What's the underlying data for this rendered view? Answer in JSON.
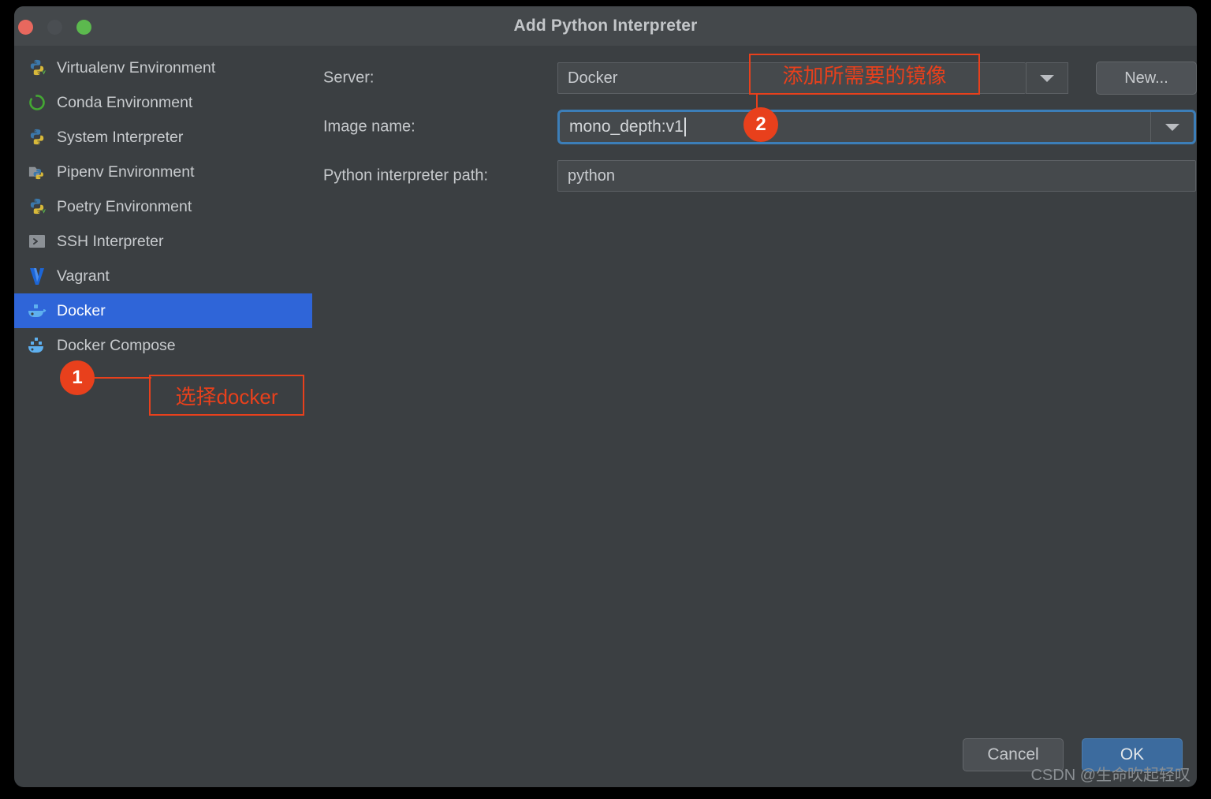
{
  "window": {
    "title": "Add Python Interpreter",
    "traffic_lights": [
      "close-red",
      "minimize-yellow",
      "zoom-green"
    ]
  },
  "colors": {
    "dialog_bg": "#3b3f42",
    "titlebar_bg": "#44484b",
    "selection_blue": "#2f65d8",
    "focus_border": "#3c7eb8",
    "annotation_red": "#e8401c",
    "ok_button_blue": "#3c6b9e",
    "text_primary": "#c8cbce"
  },
  "sidebar": {
    "items": [
      {
        "label": "Virtualenv Environment",
        "icon": "python-venv-icon",
        "selected": false
      },
      {
        "label": "Conda Environment",
        "icon": "conda-icon",
        "selected": false
      },
      {
        "label": "System Interpreter",
        "icon": "python-icon",
        "selected": false
      },
      {
        "label": "Pipenv Environment",
        "icon": "pipenv-icon",
        "selected": false
      },
      {
        "label": "Poetry Environment",
        "icon": "python-venv-icon",
        "selected": false
      },
      {
        "label": "SSH Interpreter",
        "icon": "ssh-terminal-icon",
        "selected": false
      },
      {
        "label": "Vagrant",
        "icon": "vagrant-icon",
        "selected": false
      },
      {
        "label": "Docker",
        "icon": "docker-icon",
        "selected": true
      },
      {
        "label": "Docker Compose",
        "icon": "docker-compose-icon",
        "selected": false
      }
    ]
  },
  "form": {
    "server": {
      "label": "Server:",
      "value": "Docker",
      "dropdown_icon": "chevron-down-icon"
    },
    "new_button": {
      "label": "New..."
    },
    "image_name": {
      "label": "Image name:",
      "value": "mono_depth:v1",
      "dropdown_icon": "chevron-down-icon",
      "focused": true
    },
    "python_path": {
      "label": "Python interpreter path:",
      "value": "python"
    }
  },
  "annotations": [
    {
      "id": "1",
      "text": "选择docker"
    },
    {
      "id": "2",
      "text": "添加所需要的镜像"
    }
  ],
  "footer": {
    "cancel_label": "Cancel",
    "ok_label": "OK",
    "watermark": "CSDN @生命吹起轻叹"
  }
}
